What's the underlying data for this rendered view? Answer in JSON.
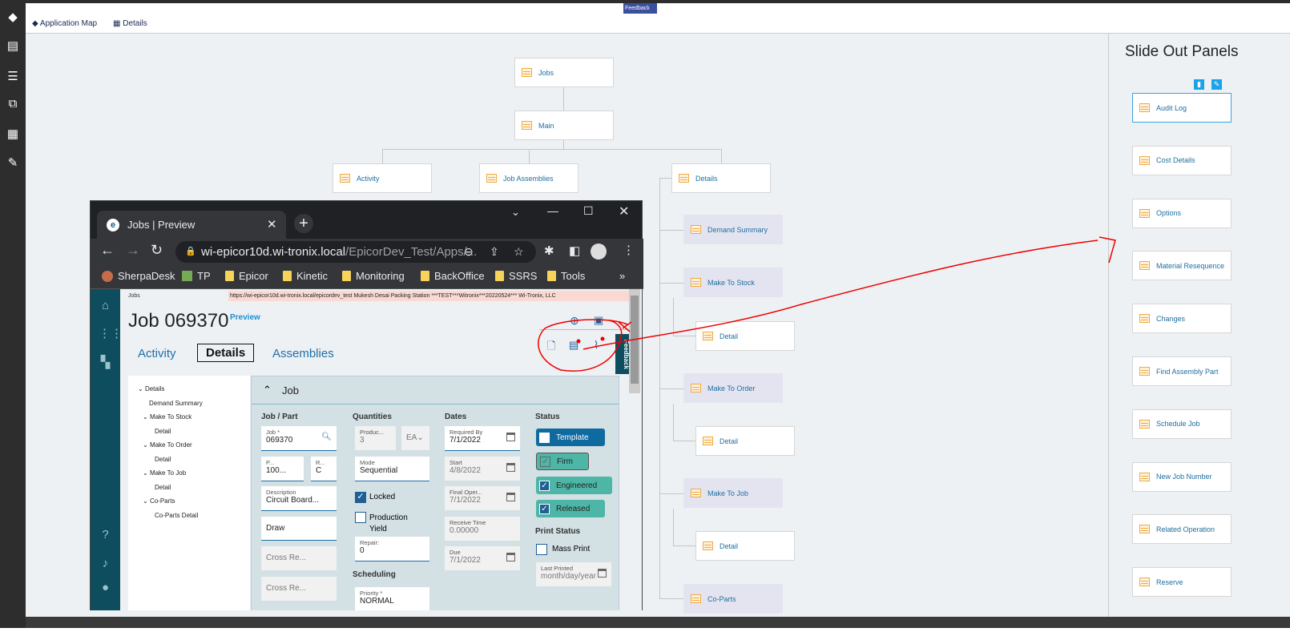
{
  "header": {
    "app_map": "Application Map",
    "details": "Details",
    "feedback": "Feedback"
  },
  "map": {
    "jobs": "Jobs",
    "main": "Main",
    "activity": "Activity",
    "job_assemblies": "Job Assemblies",
    "details": "Details",
    "demand_summary": "Demand Summary",
    "make_to_stock": "Make To Stock",
    "detail1": "Detail",
    "make_to_order": "Make To Order",
    "detail2": "Detail",
    "make_to_job": "Make To Job",
    "detail3": "Detail",
    "co_parts": "Co-Parts"
  },
  "slide_out": {
    "title": "Slide Out Panels",
    "items": [
      "Audit Log",
      "Cost Details",
      "Options",
      "Material Resequence",
      "Changes",
      "Find Assembly Part",
      "Schedule Job",
      "New Job Number",
      "Related Operation",
      "Reserve"
    ]
  },
  "browser": {
    "tab_title": "Jobs | Preview",
    "url_host": "wi-epicor10d.wi-tronix.local",
    "url_path": "/EpicorDev_Test/Apps/...",
    "bookmarks": [
      "SherpaDesk",
      "TP",
      "Epicor",
      "Kinetic",
      "Monitoring",
      "BackOffice",
      "SSRS",
      "Tools"
    ],
    "more": "»"
  },
  "app": {
    "breadcrumb": "Jobs",
    "infobar": "https://wi-epicor10d.wi-tronix.local/epicordev_test   Mukesh Desai   Packing Station   ***TEST***Witronix***20220524***   Wi-Tronix, LLC",
    "title": "Job 069370",
    "preview": "Preview",
    "tabs": [
      "Activity",
      "Details",
      "Assemblies"
    ],
    "feedback": "Feedback",
    "tree": [
      "Details",
      "Demand Summary",
      "Make To Stock",
      "Detail",
      "Make To Order",
      "Detail",
      "Make To Job",
      "Detail",
      "Co-Parts",
      "Co-Parts Detail"
    ],
    "section": "Job",
    "cols": {
      "job_part": "Job / Part",
      "quantities": "Quantities",
      "dates": "Dates",
      "status": "Status",
      "scheduling": "Scheduling",
      "print_status": "Print Status"
    },
    "fields": {
      "job_label": "Job *",
      "job_value": "069370",
      "part_label": "P...",
      "part_value": "100...",
      "rev_label": "R...",
      "rev_value": "C",
      "desc_label": "Description",
      "desc_value": "Circuit Board...",
      "draw": "Draw",
      "cross1": "Cross Re...",
      "cross2": "Cross Re...",
      "prod_label": "Produc...",
      "prod_value": "3",
      "uom": "EA",
      "mode_label": "Mode",
      "mode_value": "Sequential",
      "locked": "Locked",
      "prod_yield": "Production Yield",
      "repair_label": "Repair:",
      "repair_value": "0",
      "priority_label": "Priority *",
      "priority_value": "NORMAL",
      "req_label": "Required By",
      "req_value": "7/1/2022",
      "start_label": "Start",
      "start_value": "4/8/2022",
      "final_label": "Final Oper...",
      "final_value": "7/1/2022",
      "recv_label": "Receive Time",
      "recv_value": "0.00000",
      "due_label": "Due",
      "due_value": "7/1/2022",
      "template": "Template",
      "firm": "Firm",
      "engineered": "Engineered",
      "released": "Released",
      "mass_print": "Mass Print",
      "last_printed_label": "Last Printed",
      "last_printed_placeholder": "month/day/year"
    }
  },
  "colors": {
    "accent": "#1f6e9e",
    "nav": "#0e4d5e",
    "annotation": "#e00000"
  }
}
